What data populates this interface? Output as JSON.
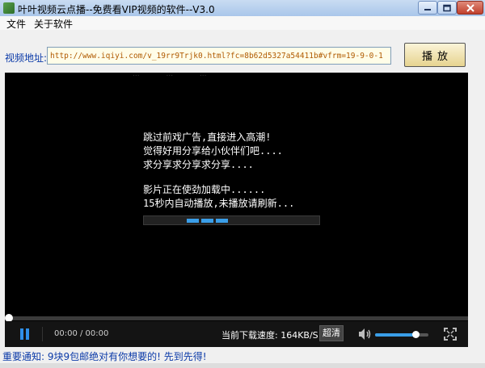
{
  "window": {
    "title": "叶叶视频云点播--免费看VIP视频的软件--V3.0",
    "icons": {
      "app": "app-icon",
      "minimize": "minimize-icon",
      "maximize": "maximize-icon",
      "close": "close-icon"
    }
  },
  "menu": {
    "items": [
      {
        "label": "文件"
      },
      {
        "label": "关于软件"
      }
    ]
  },
  "url_bar": {
    "label": "视频地址:",
    "value": "http://www.iqiyi.com/v_19rr9Trjk0.html?fc=8b62d5327a54411b#vfrm=19-9-0-1",
    "play_label": "播放"
  },
  "player": {
    "messages": [
      "跳过前戏广告,直接进入高潮!",
      "觉得好用分享给小伙伴们吧....",
      "求分享求分享求分享....",
      "影片正在使劲加载中......",
      "15秒内自动播放,未播放请刷新..."
    ],
    "faint_top_labels": [
      "...",
      "...",
      "..."
    ],
    "loading_segments": 3,
    "progress": 0.0,
    "time_display": "00:00 / 00:00",
    "speed_text": "当前下载速度: 164KB/S",
    "quality_label": "超清",
    "volume": 0.75,
    "icons": {
      "pause": "pause-icon",
      "volume": "volume-icon",
      "fullscreen": "fullscreen-icon"
    },
    "accent_color": "#3a9ee8"
  },
  "notice": "重要通知: 9块9包邮绝对有你想要的! 先到先得!"
}
